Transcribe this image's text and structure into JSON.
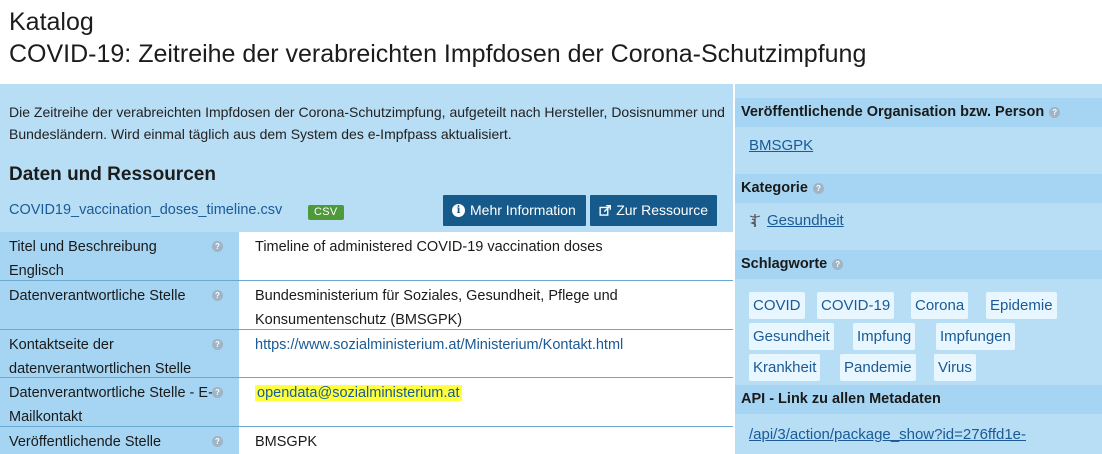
{
  "header": {
    "kicker": "Katalog",
    "title": "COVID-19: Zeitreihe der verabreichten Impfdosen der Corona-Schutzimpfung"
  },
  "main": {
    "description": "Die Zeitreihe der verabreichten Impfdosen der Corona-Schutzimpfung, aufgeteilt nach Hersteller, Dosisnummer und Bundesländern. Wird einmal täglich aus dem System des e-Impfpass aktualisiert.",
    "section_title": "Daten und Ressourcen",
    "resource": {
      "file_name": "COVID19_vaccination_doses_timeline.csv",
      "format": "CSV",
      "btn_info": "Mehr Information",
      "btn_resource": "Zur Ressource"
    },
    "help_glyph": "?",
    "rows": [
      {
        "label": "Titel und Beschreibung Englisch",
        "value": "Timeline of administered COVID-19 vaccination doses"
      },
      {
        "label": "Datenverantwortliche Stelle",
        "value": "Bundesministerium für Soziales, Gesundheit, Pflege und Konsumentenschutz (BMSGPK)"
      },
      {
        "label": "Kontaktseite der datenverantwortlichen Stelle",
        "value": "https://www.sozialministerium.at/Ministerium/Kontakt.html"
      },
      {
        "label": "Datenverantwortliche Stelle - E-Mailkontakt",
        "value": "opendata@sozialministerium.at"
      },
      {
        "label": "Veröffentlichende Stelle",
        "value": "BMSGPK"
      }
    ]
  },
  "sidebar": {
    "org_heading": "Veröffentlichende Organisation bzw. Person",
    "org_value": "BMSGPK",
    "category_heading": "Kategorie",
    "category_value": "Gesundheit",
    "tags_heading": "Schlagworte",
    "tags": [
      "COVID",
      "COVID-19",
      "Corona",
      "Epidemie",
      "Gesundheit",
      "Impfung",
      "Impfungen",
      "Krankheit",
      "Pandemie",
      "Virus"
    ],
    "api_heading": "API - Link zu allen Metadaten",
    "api_value": "/api/3/action/package_show?id=276ffd1e-"
  },
  "colors": {
    "panel": "#b8def5",
    "label_cell": "#a5d5f2",
    "button": "#155a8a",
    "link": "#1a5a96",
    "badge": "#4e9a3a",
    "highlight": "#ffff3c"
  },
  "icons": [
    "info-icon",
    "external-link-icon",
    "help-icon",
    "caduceus-icon"
  ]
}
